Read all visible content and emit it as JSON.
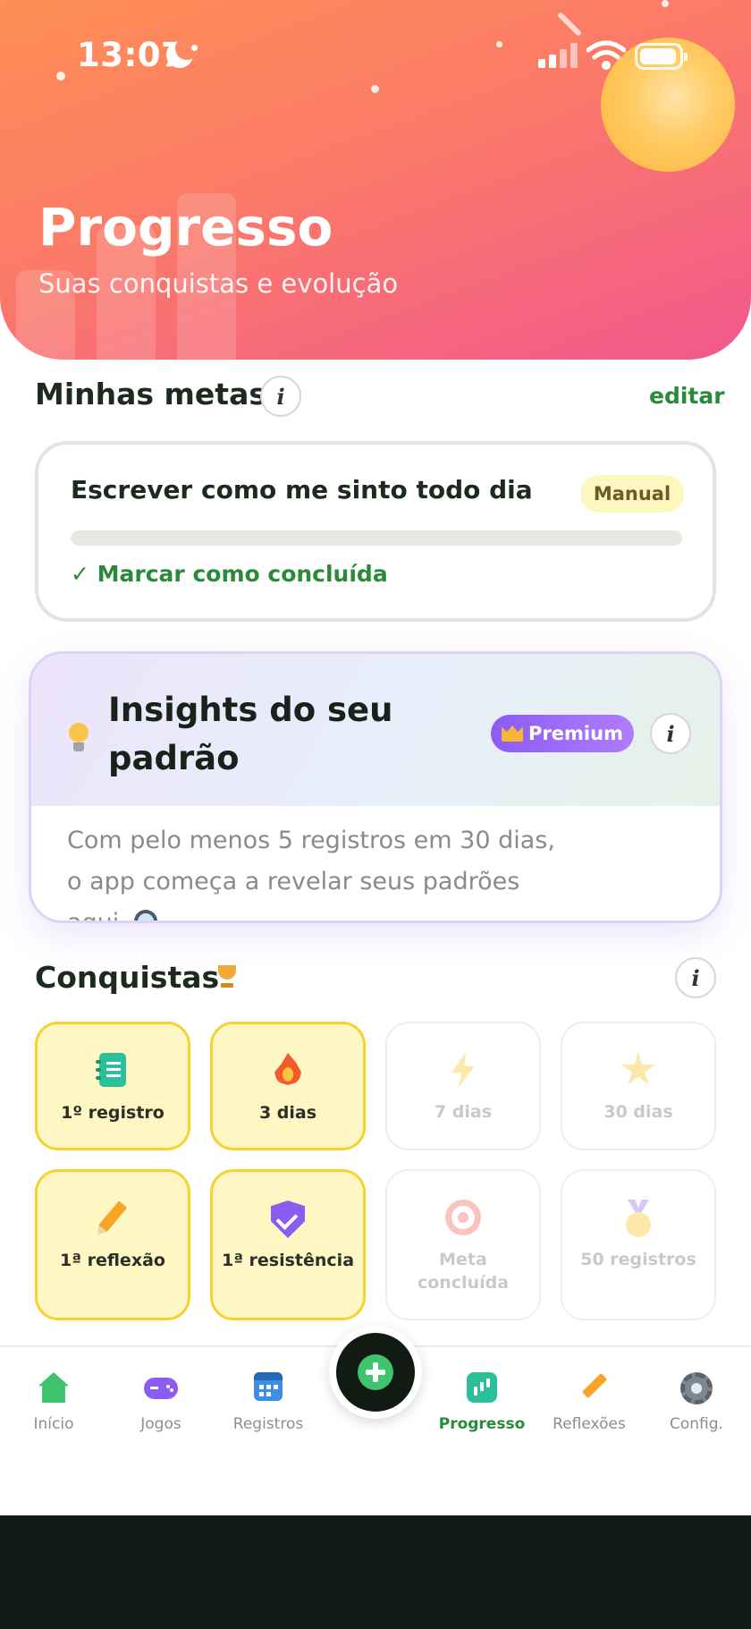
{
  "status_bar": {
    "time": "13:07"
  },
  "header": {
    "title": "Progresso",
    "subtitle": "Suas conquistas e evolução",
    "gradient": [
      "#ff8f55",
      "#f2588d"
    ]
  },
  "goals": {
    "title": "Minhas metas",
    "edit_label": "editar",
    "items": [
      {
        "name": "Escrever como me sinto todo dia",
        "badge": "Manual",
        "progress": 0,
        "action": "✓ Marcar como concluída"
      }
    ]
  },
  "insights": {
    "title": "Insights do seu padrão",
    "badge": "Premium",
    "text": "Com pelo menos 5 registros em 30 dias, o app começa a revelar seus padrões aqui."
  },
  "achievements": {
    "title": "Conquistas",
    "items": [
      {
        "label": "1º registro",
        "icon": "notebook-icon",
        "unlocked": true
      },
      {
        "label": "3 dias",
        "icon": "flame-icon",
        "unlocked": true
      },
      {
        "label": "7 dias",
        "icon": "lightning-icon",
        "unlocked": false
      },
      {
        "label": "30 dias",
        "icon": "star-icon",
        "unlocked": false
      },
      {
        "label": "1ª reflexão",
        "icon": "pencil-icon",
        "unlocked": true
      },
      {
        "label": "1ª resistência",
        "icon": "shield-check-icon",
        "unlocked": true
      },
      {
        "label": "Meta concluída",
        "icon": "target-icon",
        "unlocked": false
      },
      {
        "label": "50 registros",
        "icon": "medal-icon",
        "unlocked": false
      }
    ]
  },
  "nav": {
    "items": [
      {
        "label": "Início",
        "icon": "home-icon"
      },
      {
        "label": "Jogos",
        "icon": "gamepad-icon"
      },
      {
        "label": "Registros",
        "icon": "calendar-icon"
      },
      {
        "label": "Progresso",
        "icon": "chart-icon",
        "active": true
      },
      {
        "label": "Reflexões",
        "icon": "pencil-icon"
      },
      {
        "label": "Config.",
        "icon": "gear-icon"
      }
    ],
    "fab_icon": "plus-icon"
  },
  "colors": {
    "accent_green": "#2a8a3a",
    "premium_purple": "#8b5cf6",
    "achievement_unlocked_bg": "#fef7c4",
    "achievement_unlocked_border": "#f5d230"
  }
}
